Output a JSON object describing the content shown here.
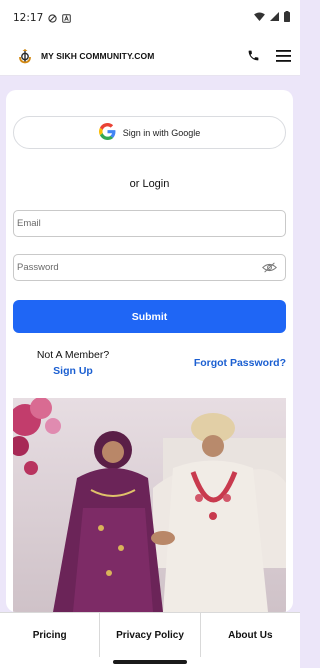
{
  "status_bar": {
    "time": "12:17",
    "icons": [
      "do-not-disturb-icon",
      "notification-a-icon",
      "wifi-icon",
      "signal-icon",
      "battery-icon"
    ]
  },
  "header": {
    "brand": "MY SIKH COMMUNITY.COM",
    "logo_icon": "khanda-logo-icon",
    "actions": [
      "phone-icon",
      "menu-icon"
    ]
  },
  "login": {
    "google_label": "Sign in with Google",
    "or_login": "or Login",
    "email_placeholder": "Email",
    "email_value": "",
    "password_placeholder": "Password",
    "password_value": "",
    "submit_label": "Submit",
    "not_member": "Not A Member?",
    "signup_label": "Sign Up",
    "forgot_label": "Forgot Password?"
  },
  "footer": {
    "items": [
      "Pricing",
      "Privacy Policy",
      "About Us"
    ]
  },
  "colors": {
    "accent": "#1f66f5",
    "link": "#1b5fd1",
    "background": "#ece6f9"
  }
}
